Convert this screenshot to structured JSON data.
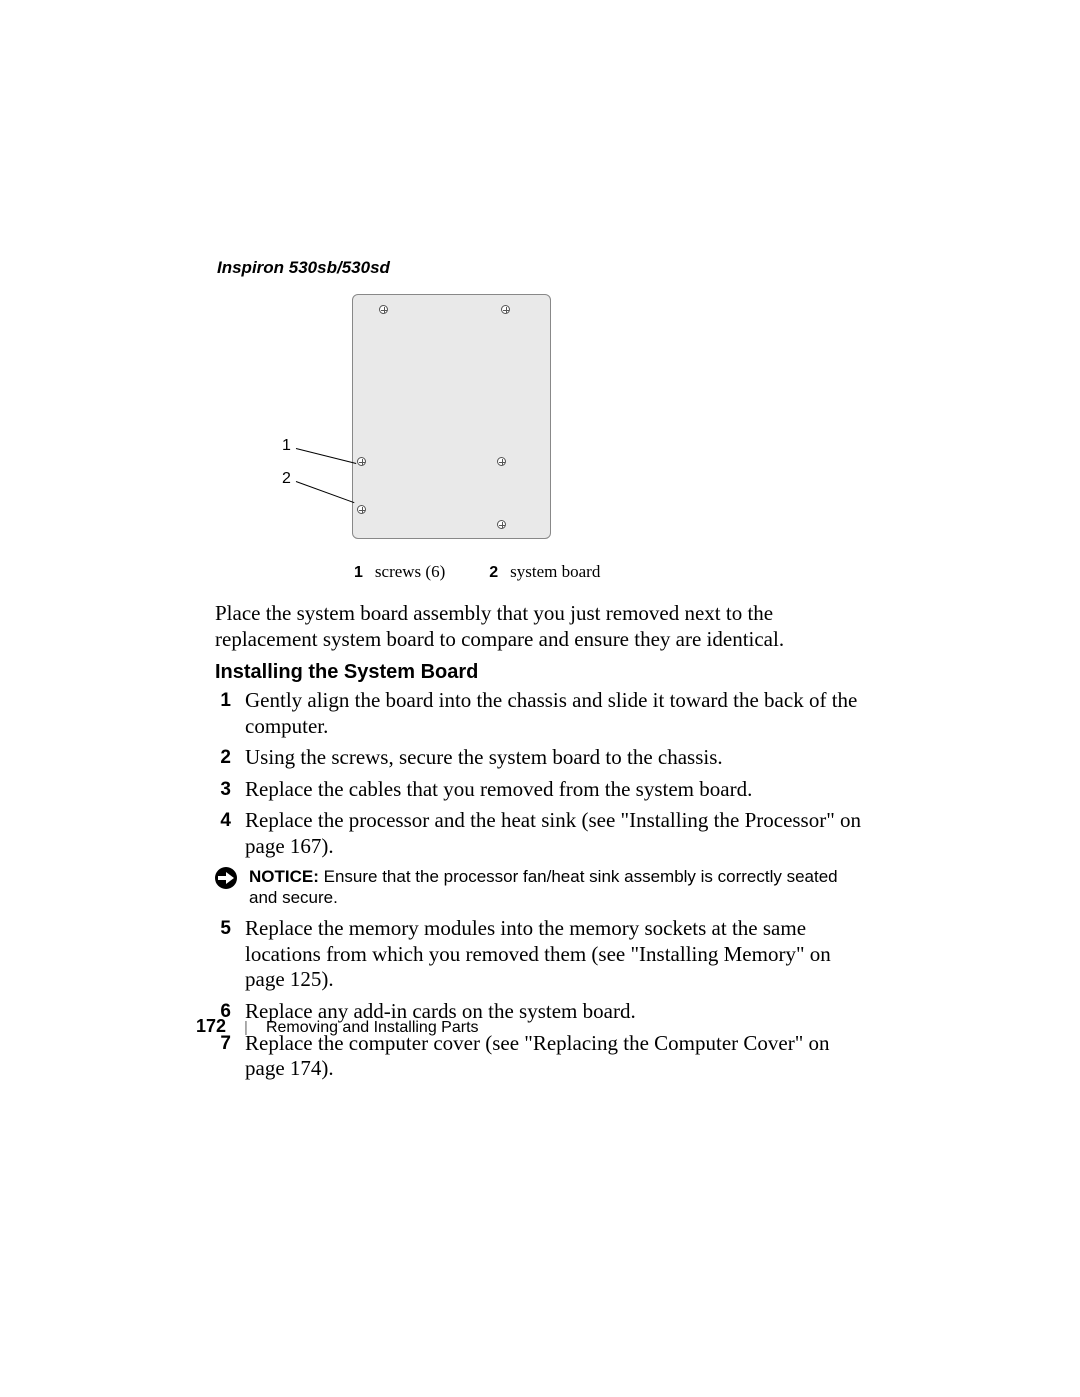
{
  "header": {
    "model": "Inspiron 530sb/530sd"
  },
  "diagram": {
    "callout1": "1",
    "callout2": "2",
    "legend": [
      {
        "num": "1",
        "text": "screws (6)"
      },
      {
        "num": "2",
        "text": "system board"
      }
    ]
  },
  "intro_para": "Place the system board assembly that you just removed next to the replacement system board to compare and ensure they are identical.",
  "section_title": "Installing the System Board",
  "steps": {
    "s1": {
      "n": "1",
      "t": "Gently align the board into the chassis and slide it toward the back of the computer."
    },
    "s2": {
      "n": "2",
      "t": "Using the screws, secure the system board to the chassis."
    },
    "s3": {
      "n": "3",
      "t": "Replace the cables that you removed from the system board."
    },
    "s4": {
      "n": "4",
      "t": "Replace the processor and the heat sink (see \"Installing the Processor\" on page 167)."
    },
    "notice": {
      "label": "NOTICE:",
      "text": " Ensure that the processor fan/heat sink assembly is correctly seated and secure."
    },
    "s5": {
      "n": "5",
      "t": "Replace the memory modules into the memory sockets at the same locations from which you removed them (see \"Installing Memory\" on page 125)."
    },
    "s6": {
      "n": "6",
      "t": "Replace any add-in cards on the system board."
    },
    "s7": {
      "n": "7",
      "t": "Replace the computer cover (see \"Replacing the Computer Cover\" on page 174)."
    }
  },
  "footer": {
    "page_number": "172",
    "section_name": "Removing and Installing Parts"
  }
}
